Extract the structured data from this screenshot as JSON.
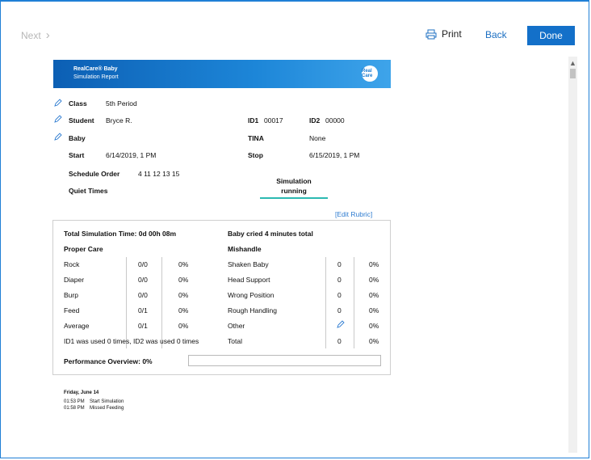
{
  "toolbar": {
    "next_label": "Next",
    "print_label": "Print",
    "back_label": "Back",
    "done_label": "Done"
  },
  "report": {
    "brand": "RealCare® Baby",
    "subtitle": "Simulation Report",
    "logo_text": "Real Care"
  },
  "info": {
    "class_label": "Class",
    "class_value": "5th Period",
    "student_label": "Student",
    "student_value": "Bryce R.",
    "baby_label": "Baby",
    "start_label": "Start",
    "start_value": "6/14/2019, 1 PM",
    "schedule_label": "Schedule Order",
    "schedule_value": "4 11 12 13 15",
    "quiet_label": "Quiet Times",
    "id1_label": "ID1",
    "id1_value": "00017",
    "id2_label": "ID2",
    "id2_value": "00000",
    "tina_label": "TINA",
    "tina_value": "None",
    "stop_label": "Stop",
    "stop_value": "6/15/2019, 1 PM",
    "status_line1": "Simulation",
    "status_line2": "running",
    "edit_rubric": "[Edit Rubric]"
  },
  "summary": {
    "total_time": "Total Simulation Time: 0d 00h 08m",
    "cried": "Baby cried 4 minutes total",
    "proper_care_header": "Proper Care",
    "mishandle_header": "Mishandle",
    "proper_care": [
      {
        "label": "Rock",
        "count": "0/0",
        "pct": "0%"
      },
      {
        "label": "Diaper",
        "count": "0/0",
        "pct": "0%"
      },
      {
        "label": "Burp",
        "count": "0/0",
        "pct": "0%"
      },
      {
        "label": "Feed",
        "count": "0/1",
        "pct": "0%"
      },
      {
        "label": "Average",
        "count": "0/1",
        "pct": "0%"
      }
    ],
    "mishandle": [
      {
        "label": "Shaken Baby",
        "count": "0",
        "pct": "0%"
      },
      {
        "label": "Head Support",
        "count": "0",
        "pct": "0%"
      },
      {
        "label": "Wrong Position",
        "count": "0",
        "pct": "0%"
      },
      {
        "label": "Rough Handling",
        "count": "0",
        "pct": "0%"
      },
      {
        "label": "Other",
        "count": "",
        "pct": "0%"
      },
      {
        "label": "Total",
        "count": "0",
        "pct": "0%"
      }
    ],
    "id_usage": "ID1 was used 0 times, ID2 was used 0 times",
    "performance": "Performance Overview: 0%",
    "performance_value": 0
  },
  "log": {
    "date": "Friday, June 14",
    "entries": [
      {
        "time": "01:53 PM",
        "event": "Start Simulation"
      },
      {
        "time": "01:58 PM",
        "event": "Missed Feeding"
      }
    ]
  },
  "colors": {
    "accent": "#1370c9",
    "status_underline": "#2cb9b2",
    "link": "#2d7bd0"
  }
}
